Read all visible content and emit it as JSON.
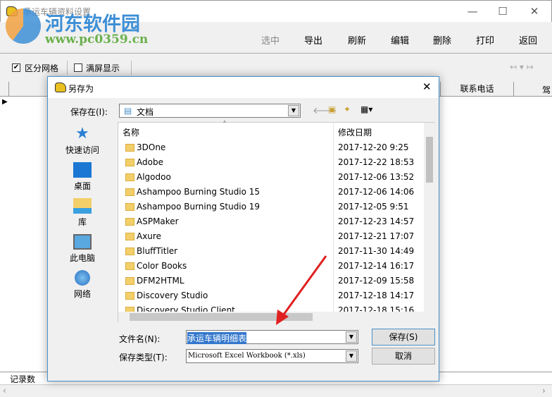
{
  "window": {
    "title": "承运车辆资料设置",
    "minimize": "—",
    "maximize": "☐",
    "close": "✕"
  },
  "watermark": {
    "line1": "河东软件园",
    "line2": "www.pc0359.cn"
  },
  "toolbar": {
    "items": [
      "选中",
      "导出",
      "刷新",
      "编辑",
      "删除",
      "打印",
      "返回"
    ]
  },
  "options": {
    "grid_label": "区分网格",
    "grid_checked": true,
    "fullscreen_label": "满屏显示",
    "fullscreen_checked": false
  },
  "table": {
    "columns": [
      "联系电话",
      "驾"
    ]
  },
  "status": {
    "records_label": "记录数"
  },
  "dialog": {
    "title": "另存为",
    "save_in_label": "保存在(I):",
    "save_in_value": "文档",
    "places": [
      "快速访问",
      "桌面",
      "库",
      "此电脑",
      "网络"
    ],
    "columns": {
      "name": "名称",
      "date": "修改日期"
    },
    "files": [
      {
        "name": "3DOne",
        "date": "2017-12-20 9:25"
      },
      {
        "name": "Adobe",
        "date": "2017-12-22 18:53"
      },
      {
        "name": "Algodoo",
        "date": "2017-12-06 13:52"
      },
      {
        "name": "Ashampoo Burning Studio 15",
        "date": "2017-12-06 14:06"
      },
      {
        "name": "Ashampoo Burning Studio 19",
        "date": "2017-12-05 9:51"
      },
      {
        "name": "ASPMaker",
        "date": "2017-12-23 14:57"
      },
      {
        "name": "Axure",
        "date": "2017-12-21 17:07"
      },
      {
        "name": "BluffTitler",
        "date": "2017-11-30 14:49"
      },
      {
        "name": "Color Books",
        "date": "2017-12-14 16:17"
      },
      {
        "name": "DFM2HTML",
        "date": "2017-12-09 15:58"
      },
      {
        "name": "Discovery Studio",
        "date": "2017-12-18 14:17"
      },
      {
        "name": "Discovery Studio Client",
        "date": "2017-12-18 15:16"
      }
    ],
    "filename_label": "文件名(N):",
    "filename_value": "承运车辆明细表",
    "filetype_label": "保存类型(T):",
    "filetype_value": "Microsoft Excel Workbook (*.xls)",
    "save_button": "保存(S)",
    "cancel_button": "取消",
    "close": "✕"
  },
  "colors": {
    "accent": "#4a90c8",
    "selection": "#3377cc",
    "arrow": "#e02020"
  }
}
